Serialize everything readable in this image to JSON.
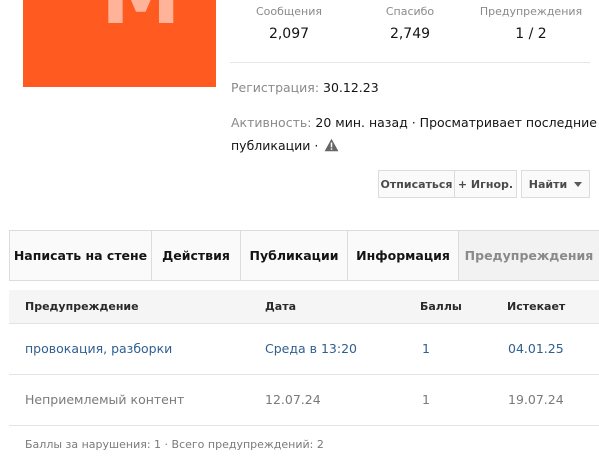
{
  "colors": {
    "avatar_bg": "#FF5A1F",
    "link": "#2f5f8f",
    "warning_icon": "#666666"
  },
  "avatar": {
    "letter": "M"
  },
  "stats": [
    {
      "label": "Сообщения",
      "value": "2,097"
    },
    {
      "label": "Спасибо",
      "value": "2,749"
    },
    {
      "label": "Предупреждения",
      "value": "1 / 2"
    }
  ],
  "registration": {
    "label": "Регистрация:",
    "value": "30.12.23"
  },
  "activity": {
    "label": "Активность:",
    "value": "20 мин. назад · Просматривает последние",
    "continuation": "публикации ·",
    "icon": "warning-icon"
  },
  "actions": {
    "unsubscribe": "Отписаться",
    "ignore": "+ Игнор.",
    "find": "Найти"
  },
  "tabs": [
    {
      "label": "Написать на стене"
    },
    {
      "label": "Действия"
    },
    {
      "label": "Публикации"
    },
    {
      "label": "Информация"
    },
    {
      "label": "Предупреждения",
      "active": true
    }
  ],
  "warnings_table": {
    "columns": [
      "Предупреждение",
      "Дата",
      "Баллы",
      "Истекает"
    ],
    "rows": [
      {
        "warning": "провокация, разборки",
        "date": "Среда в 13:20",
        "points": "1",
        "expires": "04.01.25",
        "active": true
      },
      {
        "warning": "Неприемлемый контент",
        "date": "12.07.24",
        "points": "1",
        "expires": "19.07.24",
        "active": false
      }
    ],
    "footer": "Баллы за нарушения: 1 · Всего предупреждений: 2"
  }
}
